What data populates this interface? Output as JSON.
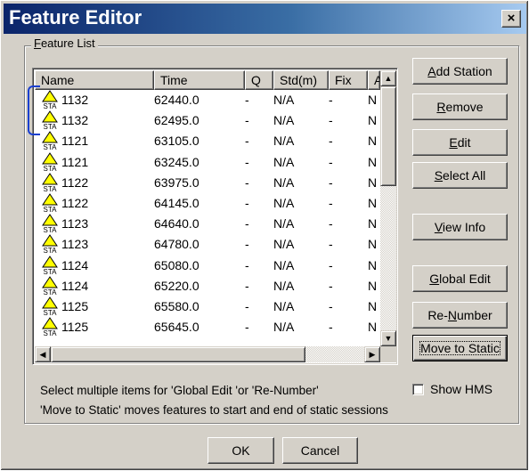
{
  "window": {
    "title": "Feature Editor",
    "close_glyph": "×"
  },
  "group": {
    "label_mnemonic": "F",
    "label_rest": "eature List"
  },
  "list": {
    "columns": [
      "Name",
      "Time",
      "Q",
      "Std(m)",
      "Fix",
      "A"
    ],
    "rows": [
      {
        "name": "1132",
        "time": "62440.0",
        "q": "-",
        "std": "N/A",
        "fix": "-",
        "a": "N"
      },
      {
        "name": "1132",
        "time": "62495.0",
        "q": "-",
        "std": "N/A",
        "fix": "-",
        "a": "N"
      },
      {
        "name": "1121",
        "time": "63105.0",
        "q": "-",
        "std": "N/A",
        "fix": "-",
        "a": "N"
      },
      {
        "name": "1121",
        "time": "63245.0",
        "q": "-",
        "std": "N/A",
        "fix": "-",
        "a": "N"
      },
      {
        "name": "1122",
        "time": "63975.0",
        "q": "-",
        "std": "N/A",
        "fix": "-",
        "a": "N"
      },
      {
        "name": "1122",
        "time": "64145.0",
        "q": "-",
        "std": "N/A",
        "fix": "-",
        "a": "N"
      },
      {
        "name": "1123",
        "time": "64640.0",
        "q": "-",
        "std": "N/A",
        "fix": "-",
        "a": "N"
      },
      {
        "name": "1123",
        "time": "64780.0",
        "q": "-",
        "std": "N/A",
        "fix": "-",
        "a": "N"
      },
      {
        "name": "1124",
        "time": "65080.0",
        "q": "-",
        "std": "N/A",
        "fix": "-",
        "a": "N"
      },
      {
        "name": "1124",
        "time": "65220.0",
        "q": "-",
        "std": "N/A",
        "fix": "-",
        "a": "N"
      },
      {
        "name": "1125",
        "time": "65580.0",
        "q": "-",
        "std": "N/A",
        "fix": "-",
        "a": "N"
      },
      {
        "name": "1125",
        "time": "65645.0",
        "q": "-",
        "std": "N/A",
        "fix": "-",
        "a": "N"
      }
    ],
    "row_icon": {
      "name": "station-icon",
      "text": "STA",
      "color": "#ffff00"
    }
  },
  "buttons": {
    "add_station": {
      "m": "A",
      "rest": "dd Station"
    },
    "remove": {
      "m": "R",
      "rest": "emove"
    },
    "edit": {
      "m": "E",
      "rest": "dit"
    },
    "select_all": {
      "pre": "",
      "m": "S",
      "rest": "elect All"
    },
    "view_info": {
      "m": "V",
      "rest": "iew Info"
    },
    "global_edit": {
      "m": "G",
      "rest": "lobal Edit"
    },
    "renumber": {
      "pre": "Re-",
      "m": "N",
      "rest": "umber"
    },
    "move_to_static": "Move to Static",
    "ok": "OK",
    "cancel": "Cancel"
  },
  "hints": {
    "line1": "Select multiple items for 'Global Edit 'or 'Re-Number'",
    "line2": "'Move to Static' moves features to start and end of static sessions"
  },
  "show_hms": {
    "label": "Show HMS",
    "checked": false
  },
  "colors": {
    "title_start": "#0a246a",
    "title_end": "#a6caf0",
    "bracket": "#1a3fd0"
  }
}
